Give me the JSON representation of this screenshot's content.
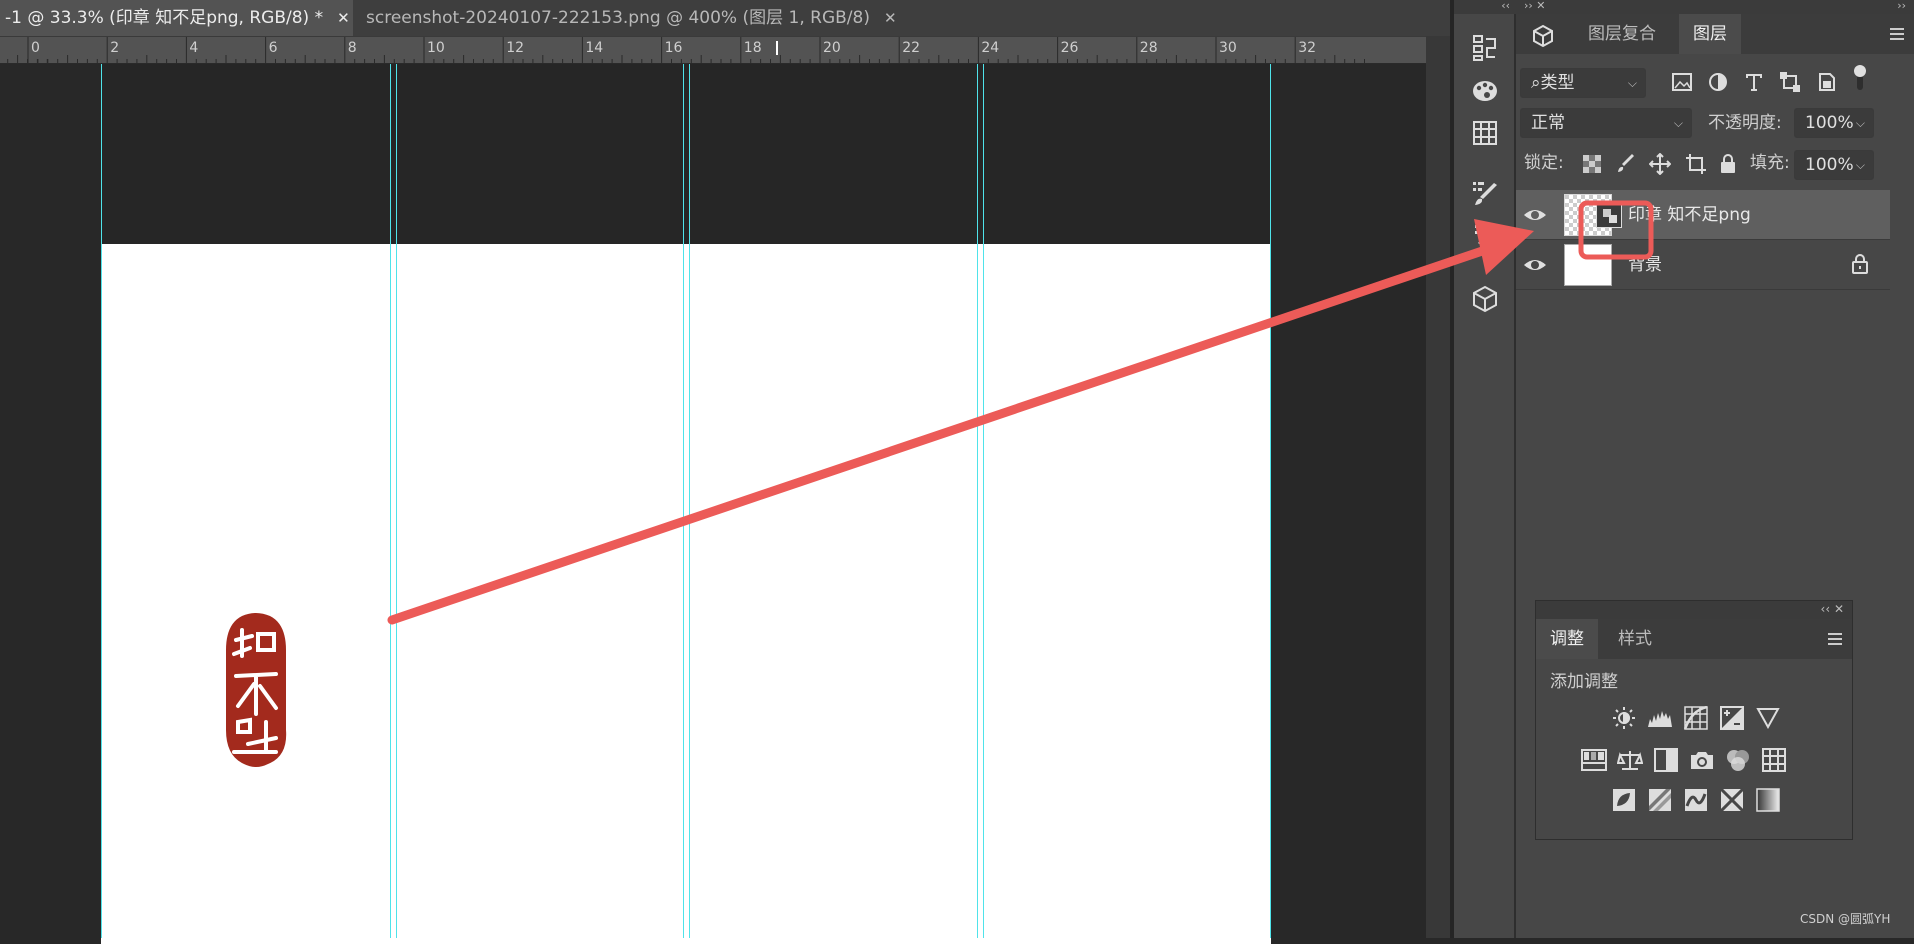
{
  "tabs": [
    {
      "label": "-1 @ 33.3% (印章 知不足png, RGB/8) *",
      "close": "✕"
    },
    {
      "label": "screenshot-20240107-222153.png  @ 400% (图层 1, RGB/8)",
      "close": "✕"
    }
  ],
  "ruler": {
    "labels": [
      "2",
      "0",
      "2",
      "4",
      "6",
      "8",
      "10",
      "12",
      "14",
      "16",
      "18",
      "20",
      "22",
      "24",
      "26",
      "28",
      "30",
      "32"
    ]
  },
  "seal": {
    "characters": "知不足",
    "color": "#a32a1d"
  },
  "layers_panel": {
    "collapse_glyphs": "›› ✕",
    "left_collapse": "‹‹",
    "tabs": [
      "图层复合",
      "图层"
    ],
    "filter_label": "类型",
    "blend_mode": "正常",
    "opacity_label": "不透明度:",
    "opacity_value": "100%",
    "lock_label": "锁定:",
    "fill_label": "填充:",
    "fill_value": "100%",
    "layers": [
      {
        "name": "印章 知不足png",
        "selected": true
      },
      {
        "name": "背景",
        "locked": true
      }
    ]
  },
  "adjustments_panel": {
    "header_glyphs": "‹‹ ✕",
    "tabs": [
      "调整",
      "样式"
    ],
    "add_label": "添加调整"
  },
  "annotation": {
    "arrow_color": "#ec5b58",
    "highlight_color": "#ec5b58"
  },
  "watermark": "CSDN @圆弧YH"
}
